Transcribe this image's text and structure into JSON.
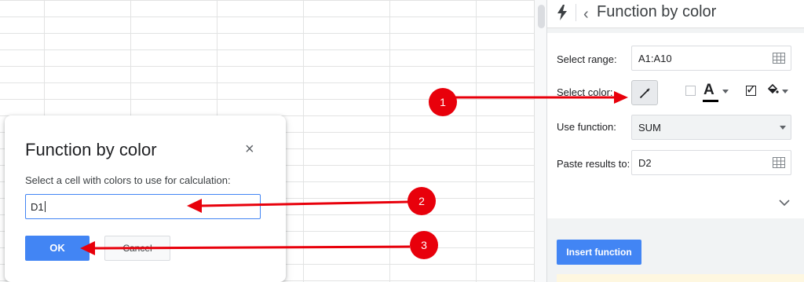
{
  "sidebar": {
    "title": "Function by color",
    "select_range_label": "Select range:",
    "select_range_value": "A1:A10",
    "select_color_label": "Select color:",
    "font_color_letter": "A",
    "use_function_label": "Use function:",
    "use_function_value": "SUM",
    "paste_results_label": "Paste results to:",
    "paste_results_value": "D2",
    "insert_button": "Insert function",
    "background_checked": true,
    "font_checked": false
  },
  "dialog": {
    "title": "Function by color",
    "close": "×",
    "prompt": "Select a cell with colors to use for calculation:",
    "input_value": "D1",
    "ok_label": "OK",
    "cancel_label": "Cancel"
  },
  "annotations": [
    "1",
    "2",
    "3"
  ],
  "colors": {
    "accent": "#4285f4",
    "annotation": "#e8000b"
  }
}
